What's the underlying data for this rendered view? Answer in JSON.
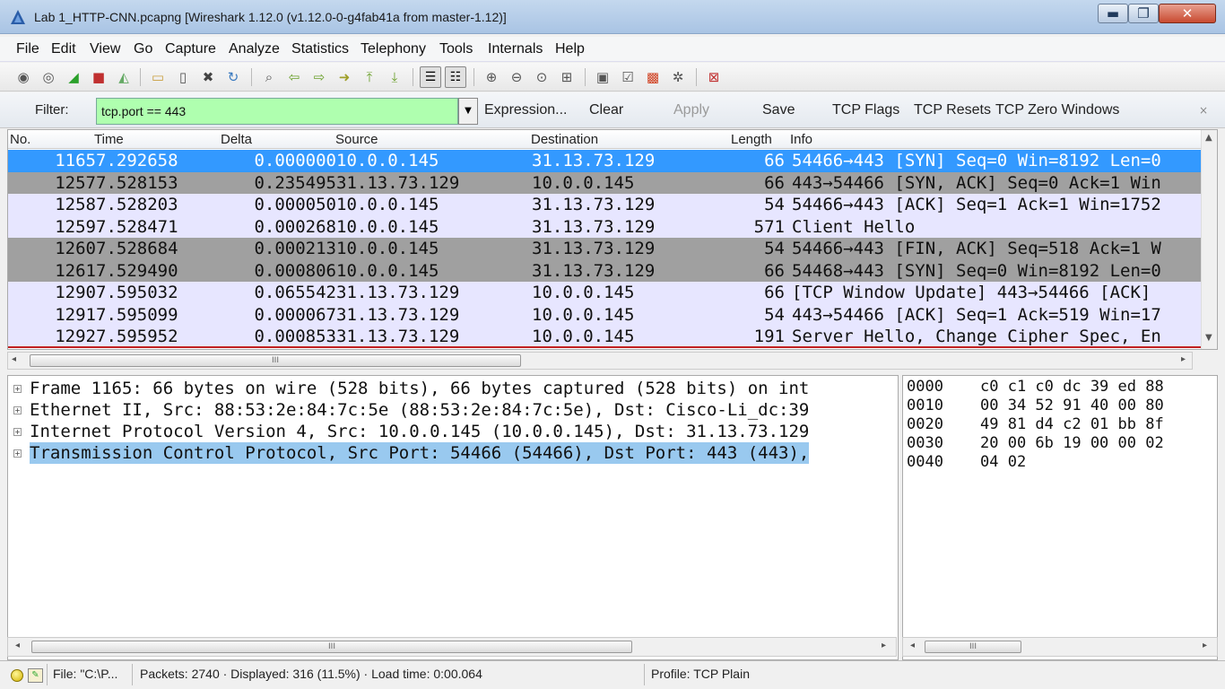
{
  "window": {
    "title": "Lab 1_HTTP-CNN.pcapng   [Wireshark 1.12.0  (v1.12.0-0-g4fab41a from master-1.12)]",
    "min_label": "▬",
    "max_label": "❐",
    "close_label": "✕"
  },
  "menu": [
    "File",
    "Edit",
    "View",
    "Go",
    "Capture",
    "Analyze",
    "Statistics",
    "Telephony",
    "Tools",
    "Internals",
    "Help"
  ],
  "filter": {
    "label": "Filter:",
    "value": "tcp.port == 443",
    "input_color": "#afffaf",
    "buttons": {
      "expression": "Expression...",
      "clear": "Clear",
      "apply": "Apply",
      "save": "Save",
      "tcp_flags": "TCP Flags",
      "tcp_resets": "TCP Resets",
      "tcp_zero_windows": "TCP Zero Windows"
    },
    "close_label": "×"
  },
  "packet_list": {
    "columns": {
      "no": "No.",
      "time": "Time",
      "delta": "Delta",
      "source": "Source",
      "destination": "Destination",
      "length": "Length",
      "info": "Info"
    },
    "colors": {
      "selected": "#3399ff",
      "light": "#e7e6ff",
      "dark": "#a0a0a0"
    },
    "rows": [
      {
        "no": "1165",
        "time": "7.292658",
        "delta": "0.000000",
        "src": "10.0.0.145",
        "dst": "31.13.73.129",
        "len": "66",
        "info": "54466→443 [SYN] Seq=0 Win=8192 Len=0",
        "style": "selected"
      },
      {
        "no": "1257",
        "time": "7.528153",
        "delta": "0.235495",
        "src": "31.13.73.129",
        "dst": "10.0.0.145",
        "len": "66",
        "info": "443→54466 [SYN, ACK] Seq=0 Ack=1 Win",
        "style": "dark"
      },
      {
        "no": "1258",
        "time": "7.528203",
        "delta": "0.000050",
        "src": "10.0.0.145",
        "dst": "31.13.73.129",
        "len": "54",
        "info": "54466→443 [ACK] Seq=1 Ack=1 Win=1752",
        "style": "light"
      },
      {
        "no": "1259",
        "time": "7.528471",
        "delta": "0.000268",
        "src": "10.0.0.145",
        "dst": "31.13.73.129",
        "len": "571",
        "info": "Client Hello",
        "style": "light"
      },
      {
        "no": "1260",
        "time": "7.528684",
        "delta": "0.000213",
        "src": "10.0.0.145",
        "dst": "31.13.73.129",
        "len": "54",
        "info": "54466→443 [FIN, ACK] Seq=518 Ack=1 W",
        "style": "dark"
      },
      {
        "no": "1261",
        "time": "7.529490",
        "delta": "0.000806",
        "src": "10.0.0.145",
        "dst": "31.13.73.129",
        "len": "66",
        "info": "54468→443 [SYN] Seq=0 Win=8192 Len=0",
        "style": "dark"
      },
      {
        "no": "1290",
        "time": "7.595032",
        "delta": "0.065542",
        "src": "31.13.73.129",
        "dst": "10.0.0.145",
        "len": "66",
        "info": "[TCP Window Update] 443→54466 [ACK]",
        "style": "light"
      },
      {
        "no": "1291",
        "time": "7.595099",
        "delta": "0.000067",
        "src": "31.13.73.129",
        "dst": "10.0.0.145",
        "len": "54",
        "info": "443→54466 [ACK] Seq=1 Ack=519 Win=17",
        "style": "light"
      },
      {
        "no": "1292",
        "time": "7.595952",
        "delta": "0.000853",
        "src": "31.13.73.129",
        "dst": "10.0.0.145",
        "len": "191",
        "info": "Server Hello, Change Cipher Spec, En",
        "style": "light"
      }
    ]
  },
  "details": {
    "expander": "+",
    "rows": [
      {
        "text": "Frame 1165: 66 bytes on wire (528 bits), 66 bytes captured (528 bits) on int",
        "selected": false
      },
      {
        "text": "Ethernet II, Src: 88:53:2e:84:7c:5e (88:53:2e:84:7c:5e), Dst: Cisco-Li_dc:39",
        "selected": false
      },
      {
        "text": "Internet Protocol Version 4, Src: 10.0.0.145 (10.0.0.145), Dst: 31.13.73.129",
        "selected": false
      },
      {
        "text": "Transmission Control Protocol, Src Port: 54466 (54466), Dst Port: 443 (443),",
        "selected": true
      }
    ]
  },
  "bytes": {
    "rows": [
      {
        "offset": "0000",
        "hex": "c0 c1 c0 dc 39 ed 88"
      },
      {
        "offset": "0010",
        "hex": "00 34 52 91 40 00 80"
      },
      {
        "offset": "0020",
        "hex": "49 81 d4 c2 01 bb 8f"
      },
      {
        "offset": "0030",
        "hex": "20 00 6b 19 00 00 02"
      },
      {
        "offset": "0040",
        "hex": "04 02"
      }
    ]
  },
  "scroll": {
    "grip": "III",
    "left": "◂",
    "right": "▸",
    "up": "▲",
    "down": "▼"
  },
  "status": {
    "file": "File: \"C:\\P...",
    "packets": "Packets: 2740 · Displayed: 316 (11.5%)  · Load time: 0:00.064",
    "profile": "Profile: TCP Plain"
  }
}
